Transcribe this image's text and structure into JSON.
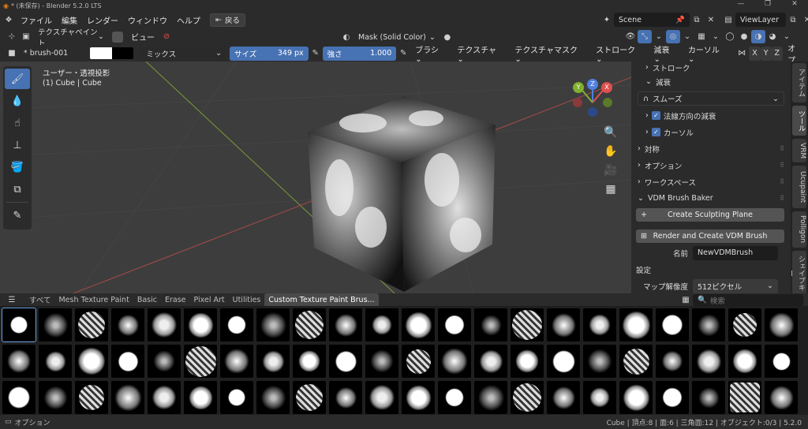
{
  "window": {
    "title": "* (未保存) - Blender 5.2.0 LTS"
  },
  "menu": {
    "items": [
      "ファイル",
      "編集",
      "レンダー",
      "ウィンドウ",
      "ヘルプ"
    ],
    "back_label": "戻る",
    "scene": "Scene",
    "view_layer": "ViewLayer"
  },
  "header1": {
    "mode": "テクスチャペイント",
    "view": "ビュー",
    "shading": "Mask (Solid Color)"
  },
  "header2": {
    "brush_name": "* brush-001",
    "blend": "ミックス",
    "size_label": "サイズ",
    "size_value": "349 px",
    "strength_label": "強さ",
    "strength_value": "1.000",
    "menus": [
      "ブラシ",
      "テクスチャ",
      "テクスチャマスク",
      "ストローク",
      "減衰",
      "カーソル"
    ],
    "axes": [
      "X",
      "Y",
      "Z"
    ],
    "options": "オプ"
  },
  "viewport": {
    "projection": "ユーザー・透視投影",
    "object": "(1) Cube | Cube",
    "gizmo": {
      "x": "X",
      "y": "Y",
      "z": "Z"
    }
  },
  "props": {
    "stroke": "ストローク",
    "falloff": "減衰",
    "falloff_preset": "スムーズ",
    "normal_falloff": "法線方向の減衰",
    "cursor": "カーソル",
    "symmetry": "対称",
    "options": "オプション",
    "workspace": "ワークスペース",
    "vdm_title": "VDM Brush Baker",
    "create_plane": "Create Sculpting Plane",
    "render_vdm": "Render and Create VDM Brush",
    "name_label": "名前",
    "name_value": "NewVDMBrush",
    "settings": "設定",
    "map_res_label": "マップ解像度",
    "map_res_value": "512ピクセル"
  },
  "vtabs": [
    "アイテム",
    "ツール",
    "VRM",
    "Ucupaint",
    "Polligon",
    "シェイプキー"
  ],
  "assets": {
    "tabs": [
      "すべて",
      "Mesh Texture Paint",
      "Basic",
      "Erase",
      "Pixel Art",
      "Utilities",
      "Custom Texture Paint Brus..."
    ],
    "active_tab": 6,
    "search_placeholder": "検索"
  },
  "status": {
    "left": "オプション",
    "right": "Cube | 頂点:8 | 面:6 | 三角面:12 | オブジェクト:0/3 | 5.2.0"
  },
  "colors": {
    "accent": "#4772b3",
    "axis_x": "#e05050",
    "axis_y": "#80b030",
    "axis_z": "#5080e0"
  }
}
